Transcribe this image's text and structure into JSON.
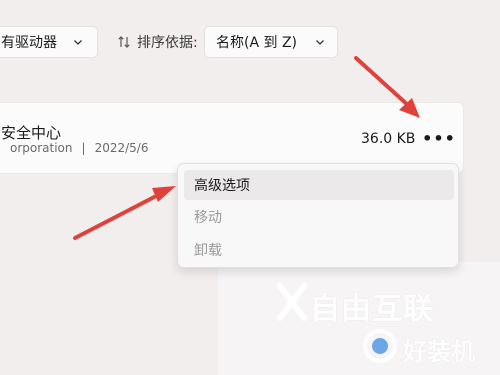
{
  "filter": {
    "selected": "有驱动器"
  },
  "sort": {
    "label": "排序依据:",
    "selected": "名称(A 到 Z)"
  },
  "app": {
    "name": "安全中心",
    "publisher": "orporation",
    "separator": "|",
    "date": "2022/5/6",
    "size": "36.0 KB",
    "more_label": "•••"
  },
  "context_menu": {
    "items": [
      {
        "label": "高级选项",
        "enabled": true
      },
      {
        "label": "移动",
        "enabled": false
      },
      {
        "label": "卸载",
        "enabled": false
      }
    ]
  },
  "annotations": {
    "arrow_color": "#e0413b"
  },
  "watermark": {
    "line1": "自由互联",
    "line2": "好装机"
  }
}
